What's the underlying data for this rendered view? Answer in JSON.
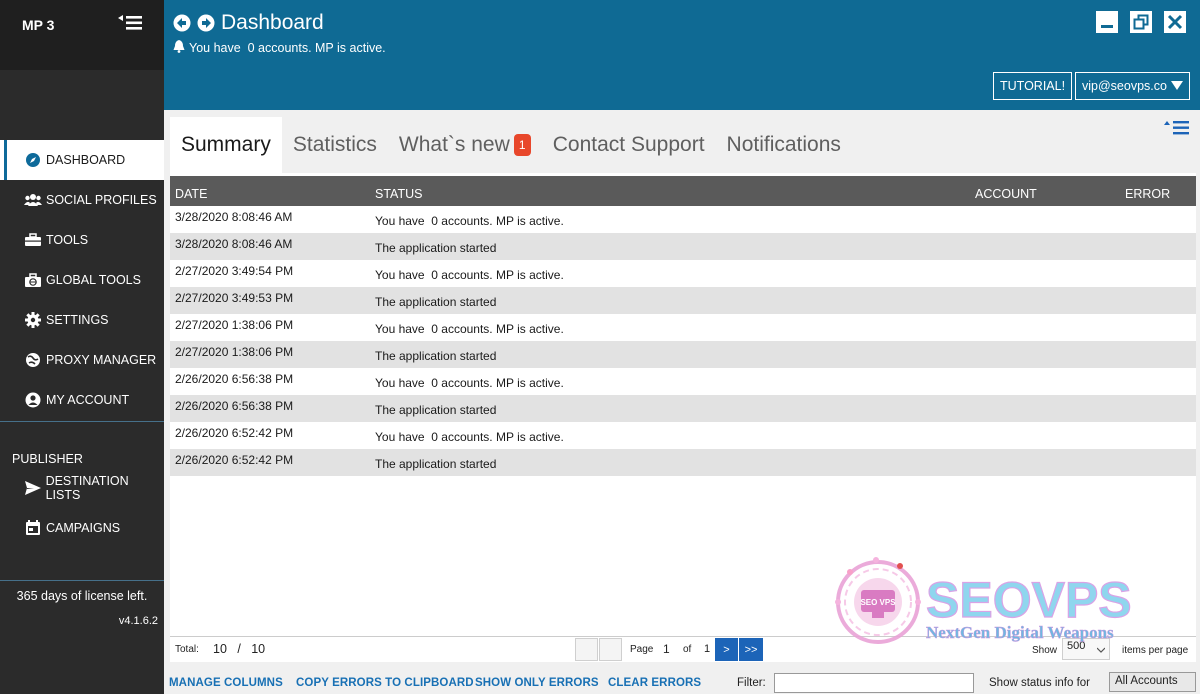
{
  "app": {
    "title": "MP 3",
    "license_text": "365 days of license left.",
    "version": "v4.1.6.2"
  },
  "sidebar": {
    "items": [
      {
        "label": "DASHBOARD",
        "icon": "compass-icon"
      },
      {
        "label": "SOCIAL PROFILES",
        "icon": "users-icon"
      },
      {
        "label": "TOOLS",
        "icon": "toolbox-icon"
      },
      {
        "label": "GLOBAL TOOLS",
        "icon": "global-tools-icon"
      },
      {
        "label": "SETTINGS",
        "icon": "gear-icon"
      },
      {
        "label": "PROXY MANAGER",
        "icon": "proxy-icon"
      },
      {
        "label": "MY ACCOUNT",
        "icon": "user-circle-icon"
      }
    ],
    "publisher_label": "PUBLISHER",
    "publisher_items": [
      {
        "label": "DESTINATION LISTS",
        "icon": "send-icon"
      },
      {
        "label": "CAMPAIGNS",
        "icon": "calendar-icon"
      }
    ]
  },
  "header": {
    "title": "Dashboard",
    "status": "You have  0 accounts. MP is active.",
    "tutorial_label": "TUTORIAL!",
    "user_label": "vip@seovps.co"
  },
  "tabs": [
    {
      "label": "Summary",
      "badge": ""
    },
    {
      "label": "Statistics",
      "badge": ""
    },
    {
      "label": "What`s new",
      "badge": "1"
    },
    {
      "label": "Contact Support",
      "badge": ""
    },
    {
      "label": "Notifications",
      "badge": ""
    }
  ],
  "table": {
    "columns": {
      "date": "DATE",
      "status": "STATUS",
      "account": "ACCOUNT",
      "error": "ERROR"
    },
    "rows": [
      {
        "date": "3/28/2020 8:08:46 AM",
        "status": "You have  0 accounts. MP is active."
      },
      {
        "date": "3/28/2020 8:08:46 AM",
        "status": "The application started"
      },
      {
        "date": "2/27/2020 3:49:54 PM",
        "status": "You have  0 accounts. MP is active."
      },
      {
        "date": "2/27/2020 3:49:53 PM",
        "status": "The application started"
      },
      {
        "date": "2/27/2020 1:38:06 PM",
        "status": "You have  0 accounts. MP is active."
      },
      {
        "date": "2/27/2020 1:38:06 PM",
        "status": "The application started"
      },
      {
        "date": "2/26/2020 6:56:38 PM",
        "status": "You have  0 accounts. MP is active."
      },
      {
        "date": "2/26/2020 6:56:38 PM",
        "status": "The application started"
      },
      {
        "date": "2/26/2020 6:52:42 PM",
        "status": "You have  0 accounts. MP is active."
      },
      {
        "date": "2/26/2020 6:52:42 PM",
        "status": "The application started"
      }
    ]
  },
  "pager": {
    "total_label": "Total:",
    "shown": "10",
    "separator": "/",
    "total": "10",
    "page_label": "Page",
    "page": "1",
    "of_label": "of",
    "pages": "1",
    "next": ">",
    "last": ">>",
    "show_label": "Show",
    "page_size": "500",
    "items_per_page": "items per page"
  },
  "bottom": {
    "manage_columns": "MANAGE COLUMNS",
    "copy_errors": "COPY ERRORS TO CLIPBOARD",
    "show_only_errors": "SHOW ONLY ERRORS",
    "clear_errors": "CLEAR ERRORS",
    "filter_label": "Filter:",
    "filter_value": "",
    "show_status_label": "Show status info for",
    "accounts_select": "All Accounts"
  },
  "watermark": {
    "brand": "SEOVPS",
    "tagline": "NextGen Digital Weapons",
    "icon_text": "SEO VPS"
  },
  "colors": {
    "header_bg": "#0f6a94",
    "sidebar_bg": "#2b2b2b",
    "link": "#1870b4",
    "badge": "#e8472b",
    "pager_blue": "#1c64b8"
  }
}
